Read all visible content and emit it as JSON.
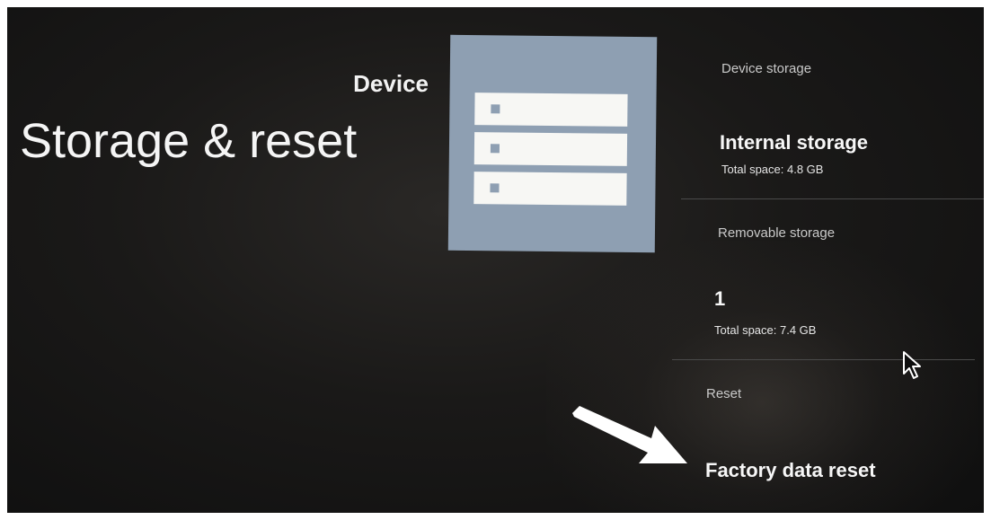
{
  "header": {
    "category": "Device",
    "title": "Storage & reset"
  },
  "sections": {
    "device_storage": {
      "header": "Device storage",
      "items": [
        {
          "title": "Internal storage",
          "subtitle": "Total space: 4.8 GB"
        }
      ]
    },
    "removable_storage": {
      "header": "Removable storage",
      "items": [
        {
          "title": "1",
          "subtitle": "Total space: 7.4 GB"
        }
      ]
    },
    "reset": {
      "header": "Reset",
      "items": [
        {
          "title": "Factory data reset"
        }
      ]
    }
  },
  "icons": {
    "storage_illustration": "storage-drives-icon",
    "pointer": "mouse-cursor-icon",
    "annotation": "white-arrow-icon"
  },
  "colors": {
    "background": "#141312",
    "illustration": "#8e9fb2",
    "text_primary": "#f7f7f7",
    "text_secondary": "#c9c9c9"
  }
}
